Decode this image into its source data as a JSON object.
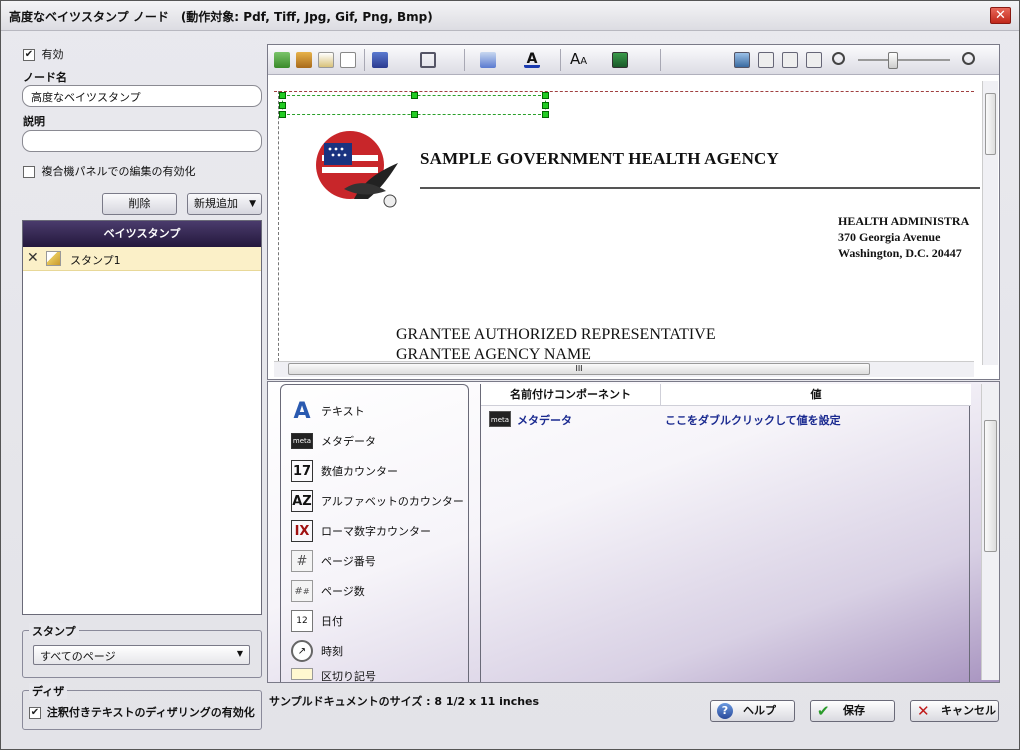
{
  "window": {
    "title": "高度なベイツスタンプ ノード　(動作対象: Pdf, Tiff, Jpg, Gif, Png, Bmp)",
    "close": "✕"
  },
  "left": {
    "enabled_label": "有効",
    "node_name_label": "ノード名",
    "node_name_value": "高度なベイツスタンプ",
    "description_label": "説明",
    "description_value": "",
    "mfp_edit_label": "複合機パネルでの編集の有効化",
    "delete_button": "削除",
    "add_new_button": "新規追加",
    "list_header": "ベイツスタンプ",
    "stamps": [
      {
        "name": "スタンプ1"
      }
    ],
    "stamp_group_label": "スタンプ",
    "stamp_pages_value": "すべてのページ",
    "dither_group_label": "ディザ",
    "dither_label": "注釈付きテキストのディザリングの有効化"
  },
  "preview": {
    "agency_name": "SAMPLE GOVERNMENT HEALTH AGENCY",
    "address_lines": [
      "HEALTH ADMINISTRA",
      "370 Georgia Avenue",
      "Washington, D.C. 20447"
    ],
    "grantee_lines": [
      "GRANTEE AUTHORIZED REPRESENTATIVE",
      "GRANTEE AGENCY NAME"
    ],
    "hscroll_grip": "III"
  },
  "components": {
    "items": [
      {
        "label": "テキスト",
        "icon": "text-icon"
      },
      {
        "label": "メタデータ",
        "icon": "meta-icon"
      },
      {
        "label": "数値カウンター",
        "icon": "numeric-counter-icon"
      },
      {
        "label": "アルファベットのカウンター",
        "icon": "alpha-counter-icon"
      },
      {
        "label": "ローマ数字カウンター",
        "icon": "roman-counter-icon"
      },
      {
        "label": "ページ番号",
        "icon": "page-number-icon"
      },
      {
        "label": "ページ数",
        "icon": "page-count-icon"
      },
      {
        "label": "日付",
        "icon": "date-icon"
      },
      {
        "label": "時刻",
        "icon": "time-icon"
      },
      {
        "label": "区切り記号",
        "icon": "separator-icon"
      }
    ]
  },
  "table": {
    "col_component": "名前付けコンポーネント",
    "col_value": "値",
    "rows": [
      {
        "component": "メタデータ",
        "value": "ここをダブルクリックして値を設定"
      }
    ]
  },
  "footer": {
    "sample_size": "サンプルドキュメントのサイズ : 8 1/2 x 11 inches",
    "help": "ヘルプ",
    "save": "保存",
    "cancel": "キャンセル"
  }
}
